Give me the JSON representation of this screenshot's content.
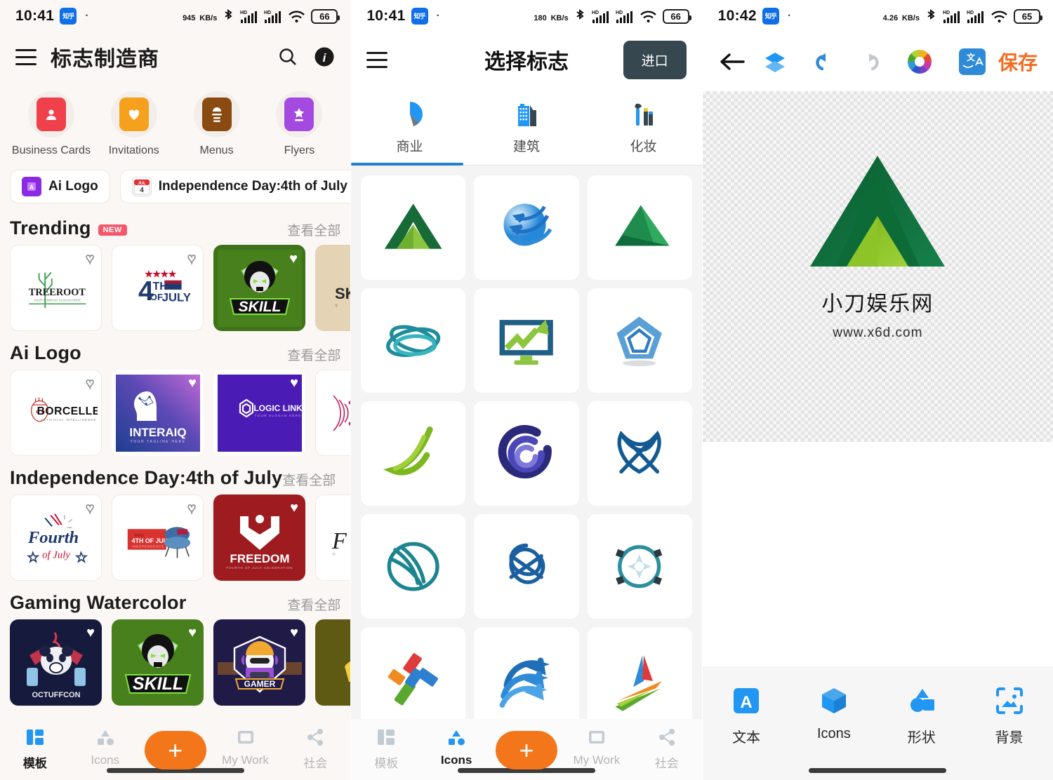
{
  "panel1": {
    "status": {
      "time": "10:41",
      "badge": "知乎",
      "net_speed": "945",
      "net_unit": "KB/s",
      "battery": "66"
    },
    "header": {
      "title": "标志制造商",
      "menu_icon": "hamburger-icon",
      "search_icon": "search-icon",
      "info_icon": "info-icon"
    },
    "categories": [
      {
        "label": "Business Cards",
        "icon": "contact-card-icon",
        "color": "#f0404c"
      },
      {
        "label": "Invitations",
        "icon": "heart-card-icon",
        "color": "#f5a11e"
      },
      {
        "label": "Menus",
        "icon": "menu-card-icon",
        "color": "#8a4b12"
      },
      {
        "label": "Flyers",
        "icon": "star-card-icon",
        "color": "#a44ae0"
      }
    ],
    "chips": [
      {
        "label": "Ai Logo",
        "icon": "ai-chip-icon"
      },
      {
        "label": "Independence Day:4th of July",
        "icon": "calendar-jul4-icon"
      },
      {
        "label": "",
        "icon": "colorful-chip-icon"
      }
    ],
    "sections": [
      {
        "title": "Trending",
        "badge": "NEW",
        "see_all": "查看全部",
        "cards": [
          {
            "name": "TREEROOT",
            "subtitle": "YOUR COMPANY SLOGAN HERE",
            "fav": false,
            "style": "treeroot"
          },
          {
            "name": "4TH OF JULY",
            "fav": false,
            "style": "fourthofjuly"
          },
          {
            "name": "SKILL",
            "fav": true,
            "style": "skill"
          },
          {
            "name": "SK",
            "fav": false,
            "style": "tan"
          }
        ]
      },
      {
        "title": "Ai Logo",
        "badge": "",
        "see_all": "查看全部",
        "cards": [
          {
            "name": "BORCELLE",
            "subtitle": "ARTIFICIAL INTELLIGENCE",
            "fav": false,
            "style": "borcelle"
          },
          {
            "name": "INTERAIQ",
            "subtitle": "YOUR TAGLINE HERE",
            "fav": true,
            "style": "interaiq"
          },
          {
            "name": "LOGIC LINK",
            "subtitle": "YOUR SLOGAN HERE",
            "fav": true,
            "style": "logiclink"
          },
          {
            "name": "",
            "fav": false,
            "style": "waves"
          }
        ]
      },
      {
        "title": "Independence Day:4th of July",
        "badge": "",
        "see_all": "查看全部",
        "cards": [
          {
            "name": "Fourth of July",
            "fav": false,
            "style": "fourth-script"
          },
          {
            "name": "4TH OF JULY",
            "subtitle": "INDEPENDENCE DAY",
            "fav": false,
            "style": "bbq"
          },
          {
            "name": "FREEDOM",
            "subtitle": "FOURTH OF JULY CELEBRATION",
            "fav": true,
            "style": "freedom"
          },
          {
            "name": "F",
            "fav": false,
            "style": "script-white"
          }
        ]
      },
      {
        "title": "Gaming Watercolor",
        "badge": "",
        "see_all": "查看全部",
        "cards": [
          {
            "name": "OCTUFFCON",
            "fav": true,
            "style": "panda"
          },
          {
            "name": "SKILL",
            "fav": true,
            "style": "skill"
          },
          {
            "name": "GAMER",
            "fav": true,
            "style": "gamer"
          },
          {
            "name": "",
            "fav": false,
            "style": "gold"
          }
        ]
      }
    ],
    "bottom_nav": [
      {
        "label": "模板",
        "icon": "templates-icon",
        "active": true
      },
      {
        "label": "Icons",
        "icon": "shapes-icon",
        "active": false
      },
      {
        "label": "",
        "icon": "plus-fab-icon",
        "active": false
      },
      {
        "label": "My Work",
        "icon": "mywork-icon",
        "active": false
      },
      {
        "label": "社会",
        "icon": "share-icon",
        "active": false
      }
    ]
  },
  "panel2": {
    "status": {
      "time": "10:41",
      "badge": "知乎",
      "net_speed": "180",
      "net_unit": "KB/s",
      "battery": "66"
    },
    "header": {
      "title": "选择标志",
      "menu_icon": "hamburger-icon",
      "import_label": "进口"
    },
    "tabs": [
      {
        "label": "商业",
        "icon": "pie-chart-icon",
        "active": true
      },
      {
        "label": "建筑",
        "icon": "buildings-icon",
        "active": false
      },
      {
        "label": "化妆",
        "icon": "makeup-icon",
        "active": false
      }
    ],
    "grid": [
      {
        "name": "green-mountain-logo"
      },
      {
        "name": "blue-globe-arrows-logo"
      },
      {
        "name": "green-triangle-logo"
      },
      {
        "name": "teal-ribbon-orbit-logo"
      },
      {
        "name": "growth-monitor-logo"
      },
      {
        "name": "blue-pentagon-logo"
      },
      {
        "name": "green-leaf-swoosh-logo"
      },
      {
        "name": "navy-circle-spiral-logo"
      },
      {
        "name": "blue-atom-knot-logo"
      },
      {
        "name": "teal-globe-lines-logo"
      },
      {
        "name": "blue-loop-knot-logo"
      },
      {
        "name": "teal-burst-ring-logo"
      },
      {
        "name": "colorful-cross-blocks-logo"
      },
      {
        "name": "blue-wave-arrows-logo"
      },
      {
        "name": "multicolor-swoosh-logo"
      }
    ],
    "bottom_nav": [
      {
        "label": "模板",
        "icon": "templates-icon",
        "active": false
      },
      {
        "label": "Icons",
        "icon": "shapes-icon",
        "active": true
      },
      {
        "label": "",
        "icon": "plus-fab-icon",
        "active": false
      },
      {
        "label": "My Work",
        "icon": "mywork-icon",
        "active": false
      },
      {
        "label": "社会",
        "icon": "share-icon",
        "active": false
      }
    ]
  },
  "panel3": {
    "status": {
      "time": "10:42",
      "badge": "知乎",
      "net_speed": "4.26",
      "net_unit": "KB/s",
      "battery": "65"
    },
    "toolbar": {
      "back_icon": "back-arrow-icon",
      "layers_icon": "layers-icon",
      "undo_icon": "undo-icon",
      "redo_icon": "redo-icon",
      "color_icon": "color-wheel-icon",
      "translate_icon": "translate-icon",
      "save_label": "保存",
      "save_color": "#f26b21"
    },
    "canvas": {
      "logo_icon": "green-mountain-logo",
      "logo_text": "小刀娱乐网",
      "logo_url": "www.x6d.com"
    },
    "tools": [
      {
        "label": "文本",
        "icon": "text-icon"
      },
      {
        "label": "Icons",
        "icon": "cube-icon"
      },
      {
        "label": "形状",
        "icon": "shapes-icon"
      },
      {
        "label": "背景",
        "icon": "image-icon"
      }
    ]
  }
}
